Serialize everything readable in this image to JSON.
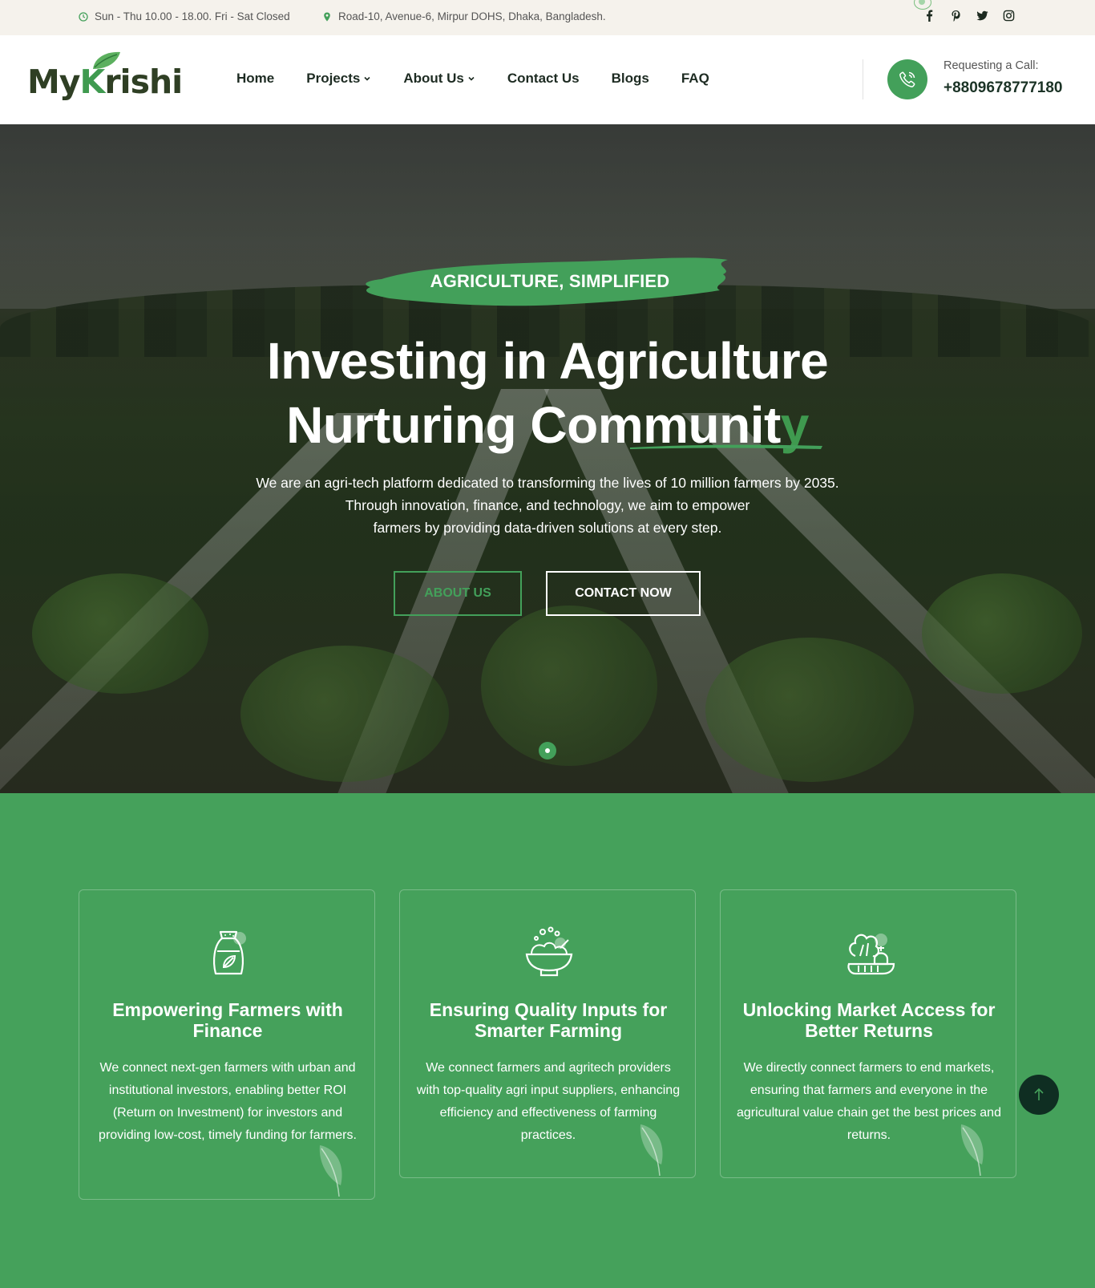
{
  "topbar": {
    "hours": "Sun - Thu 10.00 - 18.00. Fri - Sat Closed",
    "address": "Road-10, Avenue-6, Mirpur DOHS, Dhaka, Bangladesh.",
    "socials": [
      "facebook-icon",
      "pinterest-icon",
      "twitter-icon",
      "instagram-icon"
    ]
  },
  "header": {
    "logo": "MyKrishi",
    "nav": [
      {
        "label": "Home",
        "has_dropdown": false
      },
      {
        "label": "Projects",
        "has_dropdown": true
      },
      {
        "label": "About Us",
        "has_dropdown": true
      },
      {
        "label": "Contact Us",
        "has_dropdown": false
      },
      {
        "label": "Blogs",
        "has_dropdown": false
      },
      {
        "label": "FAQ",
        "has_dropdown": false
      }
    ],
    "call_label": "Requesting a Call:",
    "call_number": "+8809678777180"
  },
  "hero": {
    "badge": "AGRICULTURE, SIMPLIFIED",
    "title_line1": "Investing in Agriculture",
    "title_line2_main": "Nurturing Communit",
    "title_line2_accent": "y",
    "desc_line1": "We are an agri-tech platform dedicated to transforming the lives of 10 million farmers by 2035.",
    "desc_line2": "Through innovation, finance, and technology, we aim to empower",
    "desc_line3": "farmers by providing data-driven solutions at every step.",
    "btn_about": "ABOUT US",
    "btn_contact": "CONTACT NOW"
  },
  "features": [
    {
      "icon": "grain-sack-icon",
      "title": "Empowering Farmers with Finance",
      "text": "We connect next-gen farmers with urban and institutional investors, enabling better ROI (Return on Investment) for investors and providing low-cost, timely funding for farmers."
    },
    {
      "icon": "salad-bowl-icon",
      "title": "Ensuring Quality Inputs for Smarter Farming",
      "text": "We connect farmers and agritech providers with top-quality agri input suppliers, enhancing efficiency and effectiveness of farming practices."
    },
    {
      "icon": "vegetables-icon",
      "title": "Unlocking Market Access for Better Returns",
      "text": "We directly connect farmers to end markets, ensuring that farmers and everyone in the agricultural value chain get the best prices and returns."
    }
  ],
  "colors": {
    "brand_green": "#43a05a",
    "dark_green": "#0f2e22",
    "topbar_bg": "#f5f2ec"
  }
}
